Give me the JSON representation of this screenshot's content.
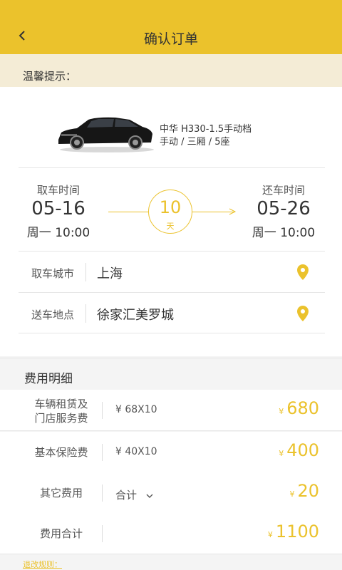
{
  "header": {
    "title": "确认订单"
  },
  "tip": {
    "label": "温馨提示："
  },
  "car": {
    "name": "中华 H330-1.5手动档",
    "spec": "手动 / 三厢 / 5座"
  },
  "pickup": {
    "label": "取车时间",
    "date": "05-16",
    "week_time": "周一 10:00"
  },
  "return": {
    "label": "还车时间",
    "date": "05-26",
    "week_time": "周一 10:00"
  },
  "duration": {
    "days": "10",
    "unit": "天"
  },
  "locations": [
    {
      "label": "取车城市",
      "value": "上海"
    },
    {
      "label": "送车地点",
      "value": "徐家汇美罗城"
    }
  ],
  "fees": {
    "title": "费用明细",
    "currency": "¥",
    "rows": [
      {
        "label_line1": "车辆租赁及",
        "label_line2": "门店服务费",
        "detail": "¥ 68X10",
        "amount": "680"
      },
      {
        "label_line1": "基本保险费",
        "label_line2": "",
        "detail": "¥ 40X10",
        "amount": "400"
      },
      {
        "label_line1": "其它费用",
        "label_line2": "",
        "detail": "合计",
        "amount": "20"
      },
      {
        "label_line1": "费用合计",
        "label_line2": "",
        "detail": "",
        "amount": "1100"
      }
    ]
  },
  "footer": {
    "rule_link": "退改规则："
  },
  "colors": {
    "accent": "#ebc22c",
    "tip_bg": "#f4ecd6"
  }
}
